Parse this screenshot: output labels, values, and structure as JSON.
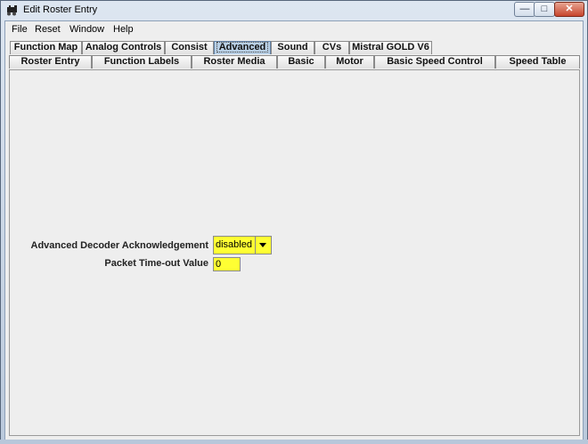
{
  "window": {
    "title": "Edit Roster Entry",
    "minimize_symbol": "—",
    "maximize_symbol": "□",
    "close_symbol": "✕"
  },
  "menu": [
    "File",
    "Reset",
    "Window",
    "Help"
  ],
  "tabs_row1": [
    {
      "label": "Function Map"
    },
    {
      "label": "Analog Controls"
    },
    {
      "label": "Consist"
    },
    {
      "label": "Advanced",
      "active": true
    },
    {
      "label": "Sound"
    },
    {
      "label": "CVs"
    },
    {
      "label": "Mistral GOLD V6"
    }
  ],
  "tabs_row2": [
    {
      "label": "Roster Entry"
    },
    {
      "label": "Function Labels"
    },
    {
      "label": "Roster Media"
    },
    {
      "label": "Basic"
    },
    {
      "label": "Motor"
    },
    {
      "label": "Basic Speed Control"
    },
    {
      "label": "Speed Table"
    }
  ],
  "form": {
    "ack_label": "Advanced Decoder Acknowledgement",
    "ack_value": "disabled",
    "timeout_label": "Packet Time-out Value",
    "timeout_value": "0"
  },
  "colors": {
    "field_bg": "#ffff33",
    "active_tab": "#b8cfe5"
  },
  "icons": {
    "app": "locomotive-icon",
    "dropdown": "triangle-down-icon"
  }
}
